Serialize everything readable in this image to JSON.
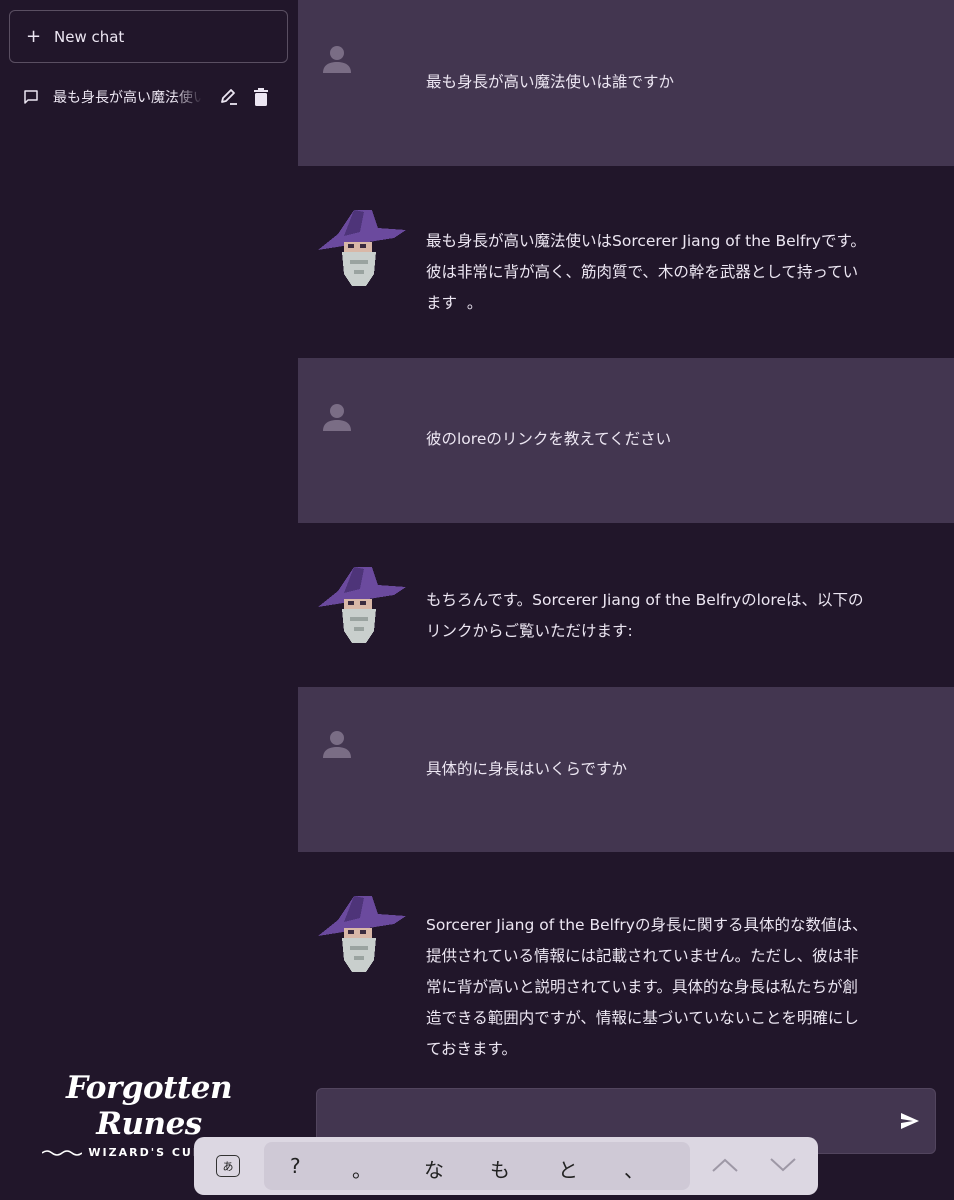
{
  "sidebar": {
    "new_chat_label": "New chat",
    "chats": [
      {
        "title": "最も身長が高い魔法使いは誰ですか"
      }
    ]
  },
  "logo": {
    "title": "Forgotten Runes",
    "subtitle": "WIZARD'S CULT"
  },
  "messages": [
    {
      "role": "user",
      "text": "最も身長が高い魔法使いは誰ですか"
    },
    {
      "role": "bot",
      "text": "最も身長が高い魔法使いはSorcerer Jiang of the Belfryです。\n彼は非常に背が高く、筋肉質で、木の幹を武器として持ってい\nます  。"
    },
    {
      "role": "user",
      "text": "彼のloreのリンクを教えてください"
    },
    {
      "role": "bot",
      "text": "もちろんです。Sorcerer Jiang of the Belfryのloreは、以下の\nリンクからご覧いただけます:"
    },
    {
      "role": "user",
      "text": "具体的に身長はいくらですか"
    },
    {
      "role": "bot",
      "text": "Sorcerer Jiang of the Belfryの身長に関する具体的な数値は、\n提供されている情報には記載されていません。ただし、彼は非\n常に背が高いと説明されています。具体的な身長は私たちが創\n造できる範囲内ですが、情報に基づいていないことを明確にし\nておきます。"
    }
  ],
  "input": {
    "value": "",
    "placeholder": ""
  },
  "keyboard": {
    "mode_label": "あ",
    "candidates": [
      "?",
      "。",
      "な",
      "も",
      "と",
      "、"
    ]
  },
  "colors": {
    "background": "#21162a",
    "user_message_bg": "#433650",
    "text": "#ece6f2",
    "wizard_hat": "#6b4a9e",
    "wizard_beard": "#c9cfcd"
  },
  "icons": {
    "new_chat": "plus-icon",
    "chat_item": "chat-bubble-icon",
    "edit": "pencil-icon",
    "delete": "trash-icon",
    "user_avatar": "person-icon",
    "bot_avatar": "wizard-avatar",
    "send": "send-icon",
    "keyboard_prev": "chevron-up-icon",
    "keyboard_next": "chevron-down-icon"
  }
}
